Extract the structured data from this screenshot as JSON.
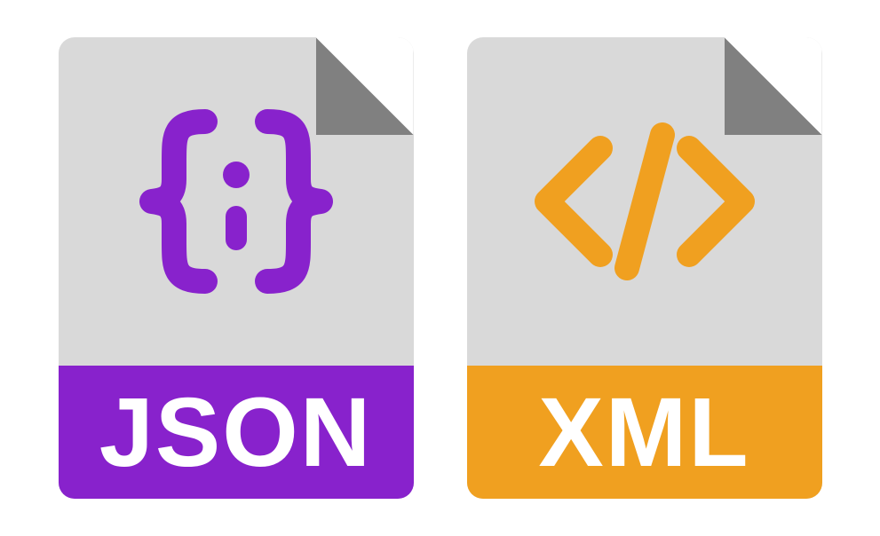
{
  "files": {
    "json": {
      "label": "JSON",
      "accent_color": "#8822cc",
      "icon_name": "json-braces-icon"
    },
    "xml": {
      "label": "XML",
      "accent_color": "#f0a020",
      "icon_name": "xml-angle-brackets-icon"
    }
  },
  "colors": {
    "file_body": "#d9d9d9",
    "fold": "#808080",
    "label_text": "#ffffff"
  }
}
